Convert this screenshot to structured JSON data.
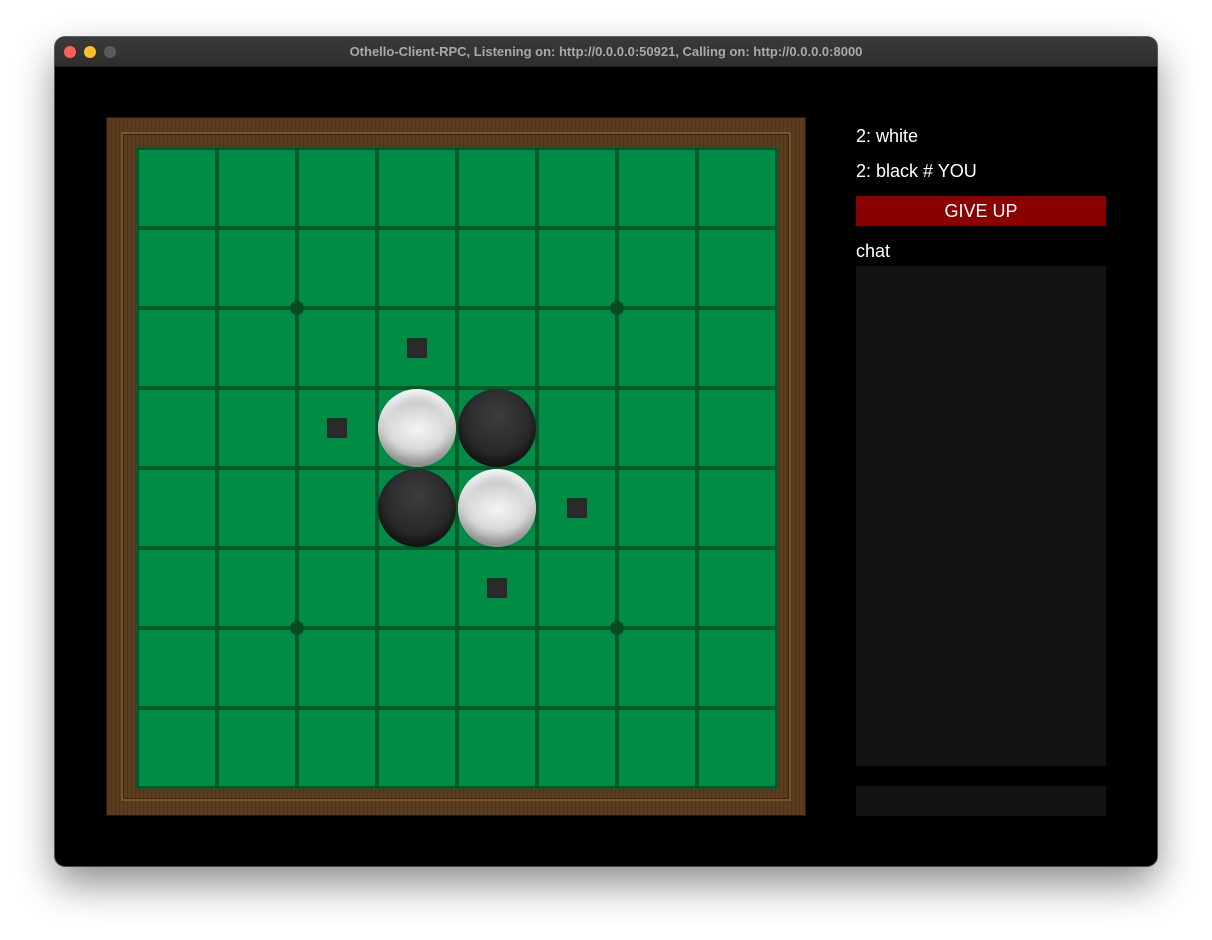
{
  "window": {
    "title": "Othello-Client-RPC, Listening on: http://0.0.0.0:50921, Calling on: http://0.0.0.0:8000"
  },
  "board": {
    "size": 8,
    "pieces": [
      {
        "row": 3,
        "col": 3,
        "color": "white"
      },
      {
        "row": 3,
        "col": 4,
        "color": "black"
      },
      {
        "row": 4,
        "col": 3,
        "color": "black"
      },
      {
        "row": 4,
        "col": 4,
        "color": "white"
      }
    ],
    "valid_moves": [
      {
        "row": 2,
        "col": 3
      },
      {
        "row": 3,
        "col": 2
      },
      {
        "row": 4,
        "col": 5
      },
      {
        "row": 5,
        "col": 4
      }
    ],
    "colors": {
      "felt": "#008c44",
      "grid_line": "#00592a",
      "frame_wood": "#5a3a1c",
      "hint": "#2a2a2a"
    }
  },
  "scores": {
    "white_line": "2: white",
    "black_line": "2: black # YOU"
  },
  "actions": {
    "give_up_label": "GIVE UP",
    "give_up_color": "#8a0000"
  },
  "chat": {
    "label": "chat",
    "messages": [],
    "input_value": ""
  }
}
